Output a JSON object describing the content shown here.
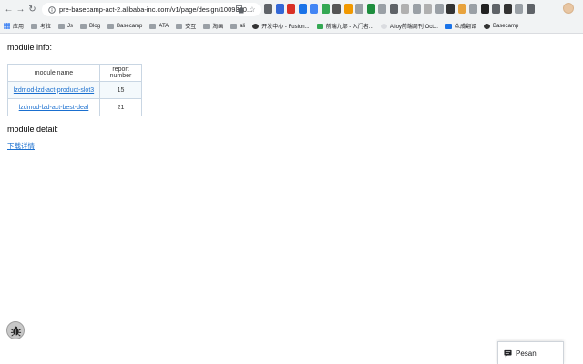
{
  "browser": {
    "url": "pre-basecamp-act-2.alibaba-inc.com/v1/page/design/1009370..."
  },
  "bookmarks": [
    {
      "label": "应用",
      "icon": "apps-grid-icon"
    },
    {
      "label": "考拉",
      "icon": "folder-icon"
    },
    {
      "label": "Js",
      "icon": "folder-icon"
    },
    {
      "label": "Blog",
      "icon": "folder-icon"
    },
    {
      "label": "Basecamp",
      "icon": "folder-icon"
    },
    {
      "label": "ATA",
      "icon": "folder-icon"
    },
    {
      "label": "交互",
      "icon": "folder-icon"
    },
    {
      "label": "淘画",
      "icon": "folder-icon"
    },
    {
      "label": "ali",
      "icon": "folder-icon"
    },
    {
      "label": "开发中心 - Fusion...",
      "icon": "site-icon"
    },
    {
      "label": "前端九部 - 入门者...",
      "icon": "site-icon"
    },
    {
      "label": "Alloy前端周刊 Oct...",
      "icon": "site-icon"
    },
    {
      "label": "众成翻译",
      "icon": "site-icon"
    },
    {
      "label": "Basecamp",
      "icon": "site-icon"
    }
  ],
  "page": {
    "module_info_title": "module info:",
    "table": {
      "headers": [
        "module name",
        "report number"
      ],
      "rows": [
        {
          "name": "lzdmod-lzd-act-product-slot3",
          "count": "15"
        },
        {
          "name": "lzdmod-lzd-act-best-deal",
          "count": "21"
        }
      ]
    },
    "module_detail_title": "module detail:",
    "download_link": "下载详情"
  },
  "feedback": {
    "label": "Pesan"
  }
}
